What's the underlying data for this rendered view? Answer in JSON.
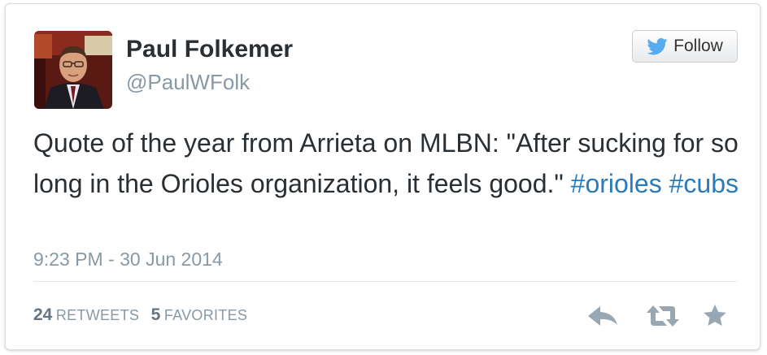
{
  "author": {
    "name": "Paul Folkemer",
    "handle": "@PaulWFolk"
  },
  "follow_button": {
    "label": "Follow",
    "icon": "twitter-bird-icon"
  },
  "tweet": {
    "text_prefix": "Quote of the year from Arrieta on MLBN: \"After sucking for so long in the Orioles organization, it feels good.\"",
    "hashtags": [
      "#orioles",
      "#cubs"
    ],
    "timestamp": "9:23 PM - 30 Jun 2014"
  },
  "stats": {
    "retweets_count": "24",
    "retweets_label": "RETWEETS",
    "favorites_count": "5",
    "favorites_label": "FAVORITES"
  },
  "actions": {
    "reply_icon": "reply-icon",
    "retweet_icon": "retweet-icon",
    "favorite_icon": "star-icon"
  },
  "colors": {
    "link": "#2b7bb9",
    "text": "#292f33",
    "muted": "#8899a6",
    "twitter_blue": "#55acee"
  }
}
